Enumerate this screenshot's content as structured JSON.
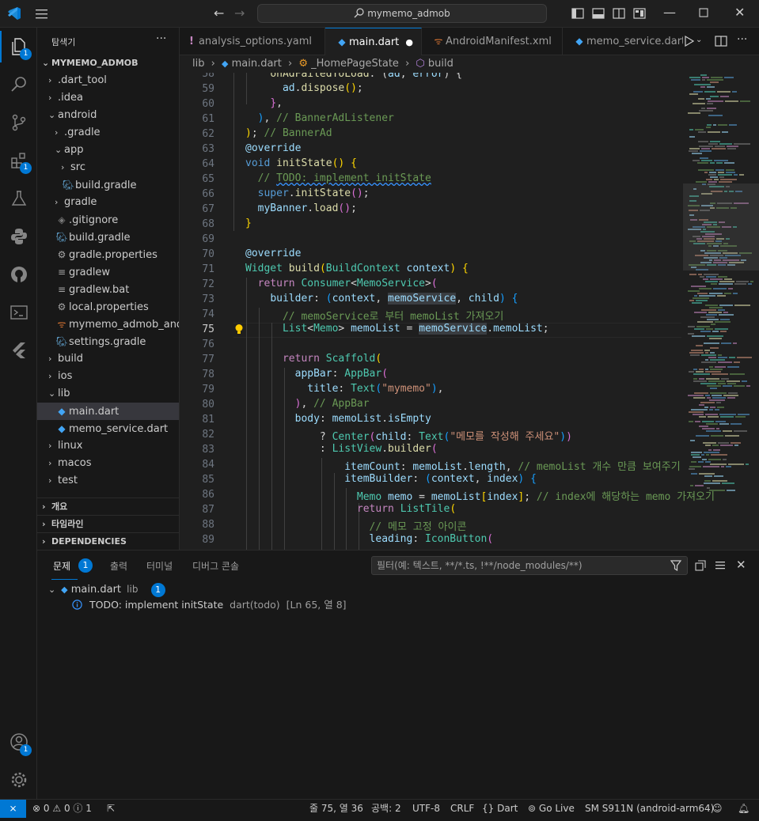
{
  "title_bar": {
    "search_text": "mymemo_admob",
    "window_controls": [
      "minimize",
      "maximize",
      "close"
    ]
  },
  "activity_bar": {
    "items": [
      "files-icon",
      "search-icon",
      "source-control-icon",
      "extensions-icon",
      "testing-icon",
      "python-icon",
      "github-icon",
      "terminal-icon",
      "flutter-icon"
    ],
    "explorer_badge": "1",
    "extensions_badge": "1",
    "account_badge": "1"
  },
  "sidebar": {
    "title": "탐색기",
    "more": "···",
    "root": "MYMEMO_ADMOB",
    "tree": [
      {
        "label": ".dart_tool",
        "chev": "›",
        "icon": "",
        "indent": 1
      },
      {
        "label": ".idea",
        "chev": "›",
        "icon": "",
        "indent": 1
      },
      {
        "label": "android",
        "chev": "⌄",
        "icon": "",
        "indent": 1
      },
      {
        "label": ".gradle",
        "chev": "›",
        "icon": "",
        "indent": 2
      },
      {
        "label": "app",
        "chev": "⌄",
        "icon": "",
        "indent": 2
      },
      {
        "label": "src",
        "chev": "›",
        "icon": "",
        "indent": 3
      },
      {
        "label": "build.gradle",
        "chev": "",
        "icon": "gradle",
        "indent": 3
      },
      {
        "label": "gradle",
        "chev": "›",
        "icon": "",
        "indent": 2
      },
      {
        "label": ".gitignore",
        "chev": "",
        "icon": "git",
        "indent": 2
      },
      {
        "label": "build.gradle",
        "chev": "",
        "icon": "gradle",
        "indent": 2
      },
      {
        "label": "gradle.properties",
        "chev": "",
        "icon": "gear",
        "indent": 2
      },
      {
        "label": "gradlew",
        "chev": "",
        "icon": "lines",
        "indent": 2
      },
      {
        "label": "gradlew.bat",
        "chev": "",
        "icon": "lines",
        "indent": 2
      },
      {
        "label": "local.properties",
        "chev": "",
        "icon": "gear",
        "indent": 2
      },
      {
        "label": "mymemo_admob_and...",
        "chev": "",
        "icon": "rss",
        "indent": 2
      },
      {
        "label": "settings.gradle",
        "chev": "",
        "icon": "gradle",
        "indent": 2
      },
      {
        "label": "build",
        "chev": "›",
        "icon": "",
        "indent": 1
      },
      {
        "label": "ios",
        "chev": "›",
        "icon": "",
        "indent": 1
      },
      {
        "label": "lib",
        "chev": "⌄",
        "icon": "",
        "indent": 1
      },
      {
        "label": "main.dart",
        "chev": "",
        "icon": "dart",
        "indent": 2,
        "active": true
      },
      {
        "label": "memo_service.dart",
        "chev": "",
        "icon": "dart",
        "indent": 2
      },
      {
        "label": "linux",
        "chev": "›",
        "icon": "",
        "indent": 1
      },
      {
        "label": "macos",
        "chev": "›",
        "icon": "",
        "indent": 1
      },
      {
        "label": "test",
        "chev": "›",
        "icon": "",
        "indent": 1
      }
    ],
    "sections": [
      "개요",
      "타임라인",
      "DEPENDENCIES"
    ]
  },
  "tabs": [
    {
      "label": "analysis_options.yaml",
      "icon": "!",
      "active": false
    },
    {
      "label": "main.dart",
      "icon": "dart",
      "active": true,
      "modified": "●"
    },
    {
      "label": "AndroidManifest.xml",
      "icon": "rss",
      "active": false
    },
    {
      "label": "memo_service.dart",
      "icon": "dart",
      "active": false
    }
  ],
  "breadcrumb": {
    "parts": [
      "lib",
      "main.dart",
      "_HomePageState",
      "build"
    ],
    "sep": "›"
  },
  "editor": {
    "current_line": 75,
    "line_numbers": [
      "58",
      "59",
      "60",
      "61",
      "62",
      "63",
      "64",
      "65",
      "66",
      "67",
      "68",
      "69",
      "70",
      "71",
      "72",
      "73",
      "74",
      "75",
      "76",
      "77",
      "78",
      "79",
      "80",
      "81",
      "82",
      "83",
      "84",
      "85",
      "86",
      "87",
      "88",
      "89"
    ]
  },
  "panel": {
    "tabs": [
      "문제",
      "출력",
      "터미널",
      "디버그 콘솔"
    ],
    "problems_badge": "1",
    "filter_placeholder": "필터(예: 텍스트, **/*.ts, !**/node_modules/**)",
    "group": {
      "file": "main.dart",
      "dir": "lib",
      "count": "1"
    },
    "problem": {
      "message": "TODO: implement initState",
      "source": "dart(todo)",
      "location": "[Ln 65, 열 8]"
    }
  },
  "status_bar": {
    "errors": "0",
    "warnings": "0",
    "infos": "1",
    "position": "줄 75, 열 36",
    "indent": "공백: 2",
    "encoding": "UTF-8",
    "eol": "CRLF",
    "language": "Dart",
    "golive": "Go Live",
    "device": "SM S911N (android-arm64)"
  },
  "colors": {
    "accent": "#0078d4",
    "background": "#1f1f1f",
    "sidebar": "#181818"
  }
}
